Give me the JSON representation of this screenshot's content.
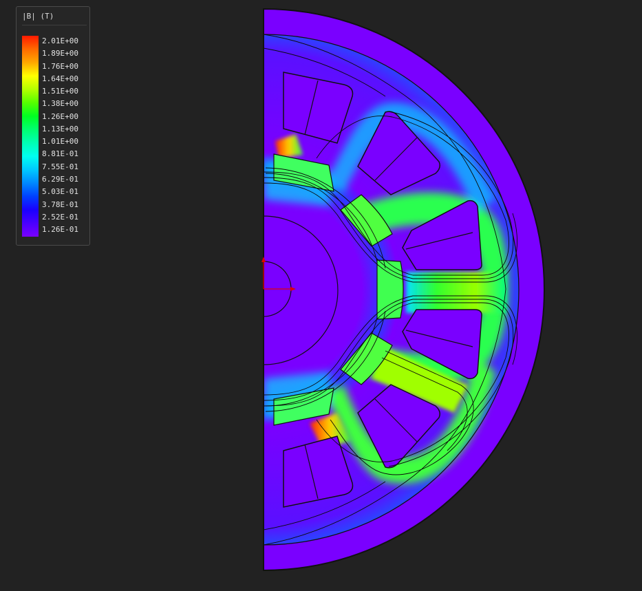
{
  "legend": {
    "title": "|B| (T)",
    "quantity": "magnetic flux density magnitude",
    "labels": [
      "2.01E+00",
      "1.89E+00",
      "1.76E+00",
      "1.64E+00",
      "1.51E+00",
      "1.38E+00",
      "1.26E+00",
      "1.13E+00",
      "1.01E+00",
      "8.81E-01",
      "7.55E-01",
      "6.29E-01",
      "5.03E-01",
      "3.78E-01",
      "2.52E-01",
      "1.26E-01"
    ],
    "colors": [
      "#ff1a00",
      "#ff6a00",
      "#ffa800",
      "#ffff00",
      "#b4ff00",
      "#55ff00",
      "#00ff22",
      "#00ff70",
      "#00ffb4",
      "#00fff0",
      "#00c8ff",
      "#0088ff",
      "#0040ff",
      "#1a00ff",
      "#4a00ff",
      "#7a00ff"
    ]
  },
  "plot": {
    "background_color": "#222222",
    "low_field_color": "#7a00ff",
    "axes_color": "#e00000",
    "icons": [
      "stator-icon",
      "rotor-icon",
      "stator-slot-icon",
      "rotor-pole-icon",
      "shaft-icon",
      "flux-line-icon",
      "coordinate-axes-icon"
    ]
  }
}
